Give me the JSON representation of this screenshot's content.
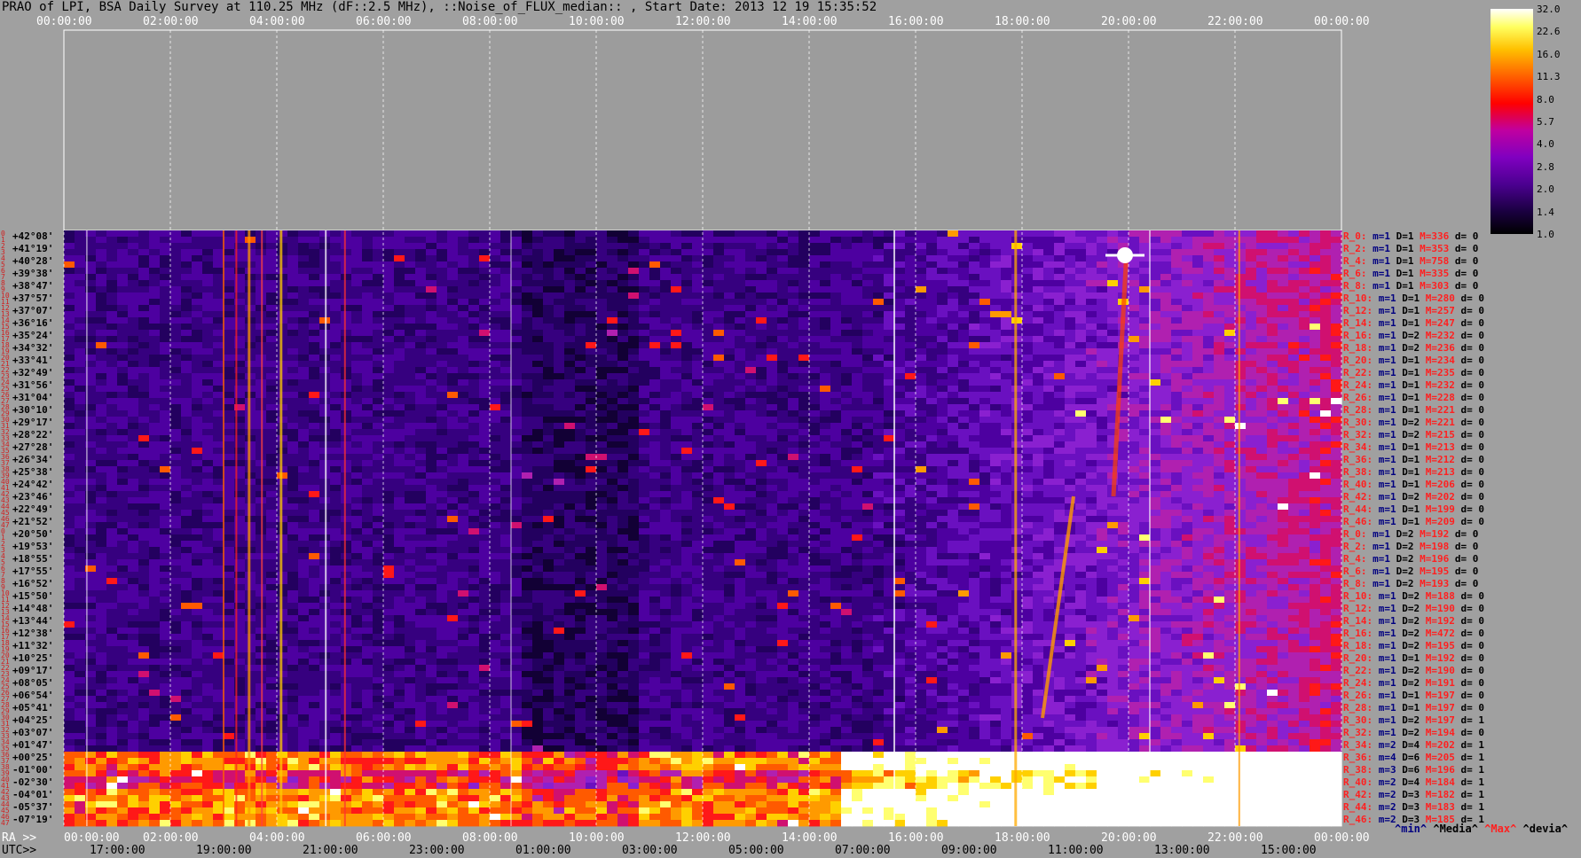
{
  "header": {
    "title": "PRAO of LPI, BSA Daily Survey at 110.25 MHz (dF::2.5 MHz), ::Noise_of_FLUX_median:: , Start Date: 2013 12 19 15:35:52"
  },
  "chart_data": {
    "type": "heatmap",
    "top_axis_ticks": [
      "00:00:00",
      "02:00:00",
      "04:00:00",
      "06:00:00",
      "08:00:00",
      "10:00:00",
      "12:00:00",
      "14:00:00",
      "16:00:00",
      "18:00:00",
      "20:00:00",
      "22:00:00",
      "00:00:00"
    ],
    "ra_axis_prefix": "RA >>",
    "ra_axis_ticks": [
      "00:00:00",
      "02:00:00",
      "04:00:00",
      "06:00:00",
      "08:00:00",
      "10:00:00",
      "12:00:00",
      "14:00:00",
      "16:00:00",
      "18:00:00",
      "20:00:00",
      "22:00:00",
      "00:00:00"
    ],
    "utc_axis_prefix": "UTC>>",
    "utc_axis_ticks": [
      "17:00:00",
      "19:00:00",
      "21:00:00",
      "23:00:00",
      "01:00:00",
      "03:00:00",
      "05:00:00",
      "07:00:00",
      "09:00:00",
      "11:00:00",
      "13:00:00",
      "15:00:00"
    ],
    "colorbar_ticks": [
      "32.0",
      "22.6",
      "16.0",
      "11.3",
      "8.0",
      "5.7",
      "4.0",
      "2.8",
      "2.0",
      "1.4",
      "1.0"
    ],
    "declinations": [
      "+42°08'",
      "+41°19'",
      "+40°28'",
      "+39°38'",
      "+38°47'",
      "+37°57'",
      "+37°07'",
      "+36°16'",
      "+35°24'",
      "+34°32'",
      "+33°41'",
      "+32°49'",
      "+31°56'",
      "+31°04'",
      "+30°10'",
      "+29°17'",
      "+28°22'",
      "+27°28'",
      "+26°34'",
      "+25°38'",
      "+24°42'",
      "+23°46'",
      "+22°49'",
      "+21°52'",
      "+20°50'",
      "+19°53'",
      "+18°55'",
      "+17°55'",
      "+16°52'",
      "+15°50'",
      "+14°48'",
      "+13°44'",
      "+12°38'",
      "+11°32'",
      "+10°25'",
      "+09°17'",
      "+08°05'",
      "+06°54'",
      "+05°41'",
      "+04°25'",
      "+03°07'",
      "+01°47'",
      "+00°25'",
      "-01°00'",
      "-02°30'",
      "-04°01'",
      "-05°37'",
      "-07°19'"
    ],
    "row_indices": [
      "0",
      "1",
      "2",
      "3",
      "4",
      "5",
      "6",
      "7",
      "8",
      "9",
      "10",
      "11",
      "12",
      "13",
      "14",
      "15",
      "16",
      "17",
      "18",
      "19",
      "20",
      "21",
      "22",
      "23",
      "24",
      "25",
      "26",
      "27",
      "28",
      "29",
      "30",
      "31",
      "32",
      "33",
      "34",
      "35",
      "36",
      "37",
      "38",
      "39",
      "40",
      "41",
      "42",
      "43",
      "44",
      "45",
      "46",
      "47",
      "0",
      "1",
      "2",
      "3",
      "4",
      "5",
      "6",
      "7",
      "8",
      "9",
      "10",
      "11",
      "12",
      "13",
      "14",
      "15",
      "16",
      "17",
      "18",
      "19",
      "20",
      "21",
      "22",
      "23",
      "24",
      "25",
      "26",
      "27",
      "28",
      "29",
      "30",
      "31",
      "32",
      "33",
      "34",
      "35",
      "36",
      "37",
      "38",
      "39",
      "40",
      "41",
      "42",
      "43",
      "44",
      "45",
      "46",
      "47"
    ],
    "receivers": [
      {
        "r": "R_0:",
        "m": "m=1",
        "d": "D=1",
        "h": "M=336",
        "e": "d= 0"
      },
      {
        "r": "R_2:",
        "m": "m=1",
        "d": "D=1",
        "h": "M=353",
        "e": "d= 0"
      },
      {
        "r": "R_4:",
        "m": "m=1",
        "d": "D=1",
        "h": "M=758",
        "e": "d= 0"
      },
      {
        "r": "R_6:",
        "m": "m=1",
        "d": "D=1",
        "h": "M=335",
        "e": "d= 0"
      },
      {
        "r": "R_8:",
        "m": "m=1",
        "d": "D=1",
        "h": "M=303",
        "e": "d= 0"
      },
      {
        "r": "R_10:",
        "m": "m=1",
        "d": "D=1",
        "h": "M=280",
        "e": "d= 0"
      },
      {
        "r": "R_12:",
        "m": "m=1",
        "d": "D=1",
        "h": "M=257",
        "e": "d= 0"
      },
      {
        "r": "R_14:",
        "m": "m=1",
        "d": "D=1",
        "h": "M=247",
        "e": "d= 0"
      },
      {
        "r": "R_16:",
        "m": "m=1",
        "d": "D=2",
        "h": "M=232",
        "e": "d= 0"
      },
      {
        "r": "R_18:",
        "m": "m=1",
        "d": "D=2",
        "h": "M=236",
        "e": "d= 0"
      },
      {
        "r": "R_20:",
        "m": "m=1",
        "d": "D=1",
        "h": "M=234",
        "e": "d= 0"
      },
      {
        "r": "R_22:",
        "m": "m=1",
        "d": "D=1",
        "h": "M=235",
        "e": "d= 0"
      },
      {
        "r": "R_24:",
        "m": "m=1",
        "d": "D=1",
        "h": "M=232",
        "e": "d= 0"
      },
      {
        "r": "R_26:",
        "m": "m=1",
        "d": "D=1",
        "h": "M=228",
        "e": "d= 0"
      },
      {
        "r": "R_28:",
        "m": "m=1",
        "d": "D=1",
        "h": "M=221",
        "e": "d= 0"
      },
      {
        "r": "R_30:",
        "m": "m=1",
        "d": "D=2",
        "h": "M=221",
        "e": "d= 0"
      },
      {
        "r": "R_32:",
        "m": "m=1",
        "d": "D=2",
        "h": "M=215",
        "e": "d= 0"
      },
      {
        "r": "R_34:",
        "m": "m=1",
        "d": "D=1",
        "h": "M=213",
        "e": "d= 0"
      },
      {
        "r": "R_36:",
        "m": "m=1",
        "d": "D=1",
        "h": "M=212",
        "e": "d= 0"
      },
      {
        "r": "R_38:",
        "m": "m=1",
        "d": "D=1",
        "h": "M=213",
        "e": "d= 0"
      },
      {
        "r": "R_40:",
        "m": "m=1",
        "d": "D=1",
        "h": "M=206",
        "e": "d= 0"
      },
      {
        "r": "R_42:",
        "m": "m=1",
        "d": "D=2",
        "h": "M=202",
        "e": "d= 0"
      },
      {
        "r": "R_44:",
        "m": "m=1",
        "d": "D=1",
        "h": "M=199",
        "e": "d= 0"
      },
      {
        "r": "R_46:",
        "m": "m=1",
        "d": "D=1",
        "h": "M=209",
        "e": "d= 0"
      },
      {
        "r": "R_0:",
        "m": "m=1",
        "d": "D=2",
        "h": "M=192",
        "e": "d= 0"
      },
      {
        "r": "R_2:",
        "m": "m=1",
        "d": "D=2",
        "h": "M=198",
        "e": "d= 0"
      },
      {
        "r": "R_4:",
        "m": "m=1",
        "d": "D=2",
        "h": "M=196",
        "e": "d= 0"
      },
      {
        "r": "R_6:",
        "m": "m=1",
        "d": "D=2",
        "h": "M=195",
        "e": "d= 0"
      },
      {
        "r": "R_8:",
        "m": "m=1",
        "d": "D=2",
        "h": "M=193",
        "e": "d= 0"
      },
      {
        "r": "R_10:",
        "m": "m=1",
        "d": "D=2",
        "h": "M=188",
        "e": "d= 0"
      },
      {
        "r": "R_12:",
        "m": "m=1",
        "d": "D=2",
        "h": "M=190",
        "e": "d= 0"
      },
      {
        "r": "R_14:",
        "m": "m=1",
        "d": "D=2",
        "h": "M=192",
        "e": "d= 0"
      },
      {
        "r": "R_16:",
        "m": "m=1",
        "d": "D=2",
        "h": "M=472",
        "e": "d= 0"
      },
      {
        "r": "R_18:",
        "m": "m=1",
        "d": "D=2",
        "h": "M=195",
        "e": "d= 0"
      },
      {
        "r": "R_20:",
        "m": "m=1",
        "d": "D=1",
        "h": "M=192",
        "e": "d= 0"
      },
      {
        "r": "R_22:",
        "m": "m=1",
        "d": "D=2",
        "h": "M=190",
        "e": "d= 0"
      },
      {
        "r": "R_24:",
        "m": "m=1",
        "d": "D=2",
        "h": "M=191",
        "e": "d= 0"
      },
      {
        "r": "R_26:",
        "m": "m=1",
        "d": "D=1",
        "h": "M=197",
        "e": "d= 0"
      },
      {
        "r": "R_28:",
        "m": "m=1",
        "d": "D=1",
        "h": "M=197",
        "e": "d= 0"
      },
      {
        "r": "R_30:",
        "m": "m=1",
        "d": "D=2",
        "h": "M=197",
        "e": "d= 1"
      },
      {
        "r": "R_32:",
        "m": "m=1",
        "d": "D=2",
        "h": "M=194",
        "e": "d= 0"
      },
      {
        "r": "R_34:",
        "m": "m=2",
        "d": "D=4",
        "h": "M=202",
        "e": "d= 1"
      },
      {
        "r": "R_36:",
        "m": "m=4",
        "d": "D=6",
        "h": "M=205",
        "e": "d= 1"
      },
      {
        "r": "R_38:",
        "m": "m=3",
        "d": "D=6",
        "h": "M=196",
        "e": "d= 1"
      },
      {
        "r": "R_40:",
        "m": "m=2",
        "d": "D=4",
        "h": "M=184",
        "e": "d= 1"
      },
      {
        "r": "R_42:",
        "m": "m=2",
        "d": "D=3",
        "h": "M=182",
        "e": "d= 1"
      },
      {
        "r": "R_44:",
        "m": "m=2",
        "d": "D=3",
        "h": "M=183",
        "e": "d= 1"
      },
      {
        "r": "R_46:",
        "m": "m=2",
        "d": "D=3",
        "h": "M=185",
        "e": "d= 1"
      }
    ],
    "legend": {
      "min": "^min^",
      "median": "^Media^",
      "max": "^Max^",
      "devia": "^devia^"
    }
  },
  "colors": {
    "background": "#a0a0a0",
    "label_red": "#ff2020",
    "label_navy": "#000080"
  }
}
